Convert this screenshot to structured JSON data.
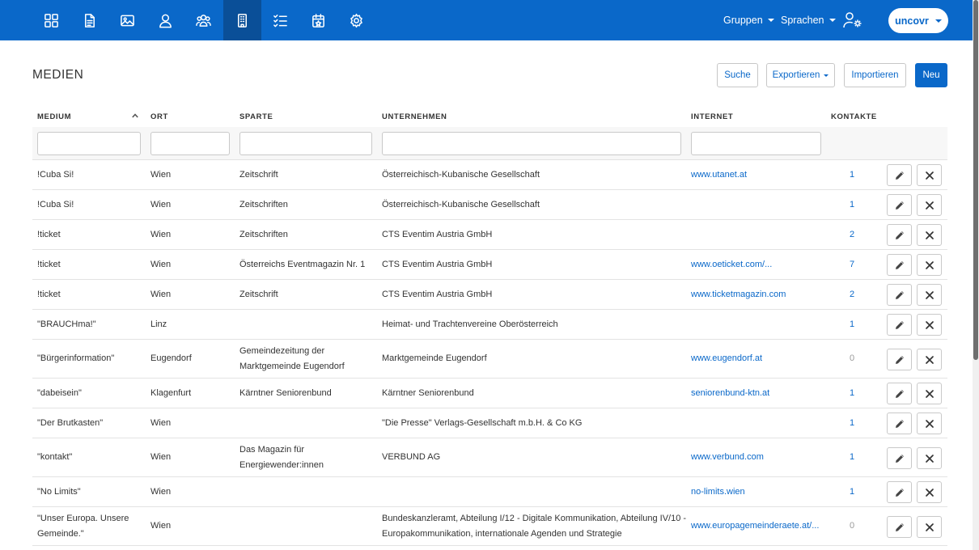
{
  "nav": {
    "icons": [
      "dashboard-icon",
      "document-icon",
      "image-icon",
      "person-icon",
      "people-icon",
      "building-icon",
      "checklist-icon",
      "calendar-icon",
      "gear-icon"
    ],
    "active_index": 5,
    "menu_groups": "Gruppen",
    "menu_languages": "Sprachen",
    "user_settings_icon": "user-settings-icon",
    "user_name": "uncovr"
  },
  "page": {
    "title": "MEDIEN",
    "buttons": {
      "search": "Suche",
      "export": "Exportieren",
      "import": "Importieren",
      "new": "Neu"
    }
  },
  "table": {
    "columns": [
      "MEDIUM",
      "ORT",
      "SPARTE",
      "UNTERNEHMEN",
      "INTERNET",
      "KONTAKTE"
    ],
    "rows": [
      {
        "medium": "!Cuba Si!",
        "ort": "Wien",
        "sparte": "Zeitschrift",
        "unternehmen": "Österreichisch-Kubanische Gesellschaft",
        "internet": "www.utanet.at",
        "kontakte": "1"
      },
      {
        "medium": "!Cuba Si!",
        "ort": "Wien",
        "sparte": "Zeitschriften",
        "unternehmen": "Österreichisch-Kubanische Gesellschaft",
        "internet": "",
        "kontakte": "1"
      },
      {
        "medium": "!ticket",
        "ort": "Wien",
        "sparte": "Zeitschriften",
        "unternehmen": "CTS Eventim Austria GmbH",
        "internet": "",
        "kontakte": "2"
      },
      {
        "medium": "!ticket",
        "ort": "Wien",
        "sparte": "Österreichs Eventmagazin Nr. 1",
        "unternehmen": "CTS Eventim Austria GmbH",
        "internet": "www.oeticket.com/...",
        "kontakte": "7"
      },
      {
        "medium": "!ticket",
        "ort": "Wien",
        "sparte": "Zeitschrift",
        "unternehmen": "CTS Eventim Austria GmbH",
        "internet": "www.ticketmagazin.com",
        "kontakte": "2"
      },
      {
        "medium": "\"BRAUCHma!\"",
        "ort": "Linz",
        "sparte": "",
        "unternehmen": "Heimat- und Trachtenvereine Oberösterreich",
        "internet": "",
        "kontakte": "1"
      },
      {
        "medium": "\"Bürgerinformation\"",
        "ort": "Eugendorf",
        "sparte": "Gemeindezeitung der Marktgemeinde Eugendorf",
        "unternehmen": "Marktgemeinde Eugendorf",
        "internet": "www.eugendorf.at",
        "kontakte": "0"
      },
      {
        "medium": "\"dabeisein\"",
        "ort": "Klagenfurt",
        "sparte": "Kärntner Seniorenbund",
        "unternehmen": "Kärntner Seniorenbund",
        "internet": "seniorenbund-ktn.at",
        "kontakte": "1"
      },
      {
        "medium": "\"Der Brutkasten\"",
        "ort": "Wien",
        "sparte": "",
        "unternehmen": "\"Die Presse\" Verlags-Gesellschaft m.b.H. & Co KG",
        "internet": "",
        "kontakte": "1"
      },
      {
        "medium": "\"kontakt\"",
        "ort": "Wien",
        "sparte": "Das Magazin für Energiewender:innen",
        "unternehmen": "VERBUND AG",
        "internet": "www.verbund.com",
        "kontakte": "1"
      },
      {
        "medium": "\"No Limits\"",
        "ort": "Wien",
        "sparte": "",
        "unternehmen": "",
        "internet": "no-limits.wien",
        "kontakte": "1"
      },
      {
        "medium": "\"Unser Europa. Unsere Gemeinde.\"",
        "ort": "Wien",
        "sparte": "",
        "unternehmen": "Bundeskanzleramt, Abteilung I/12 - Digitale Kommunikation, Abteilung IV/10 - Europakommunikation, internationale Agenden und Strategie",
        "internet": "www.europagemeinderaete.at/...",
        "kontakte": "0"
      }
    ]
  }
}
